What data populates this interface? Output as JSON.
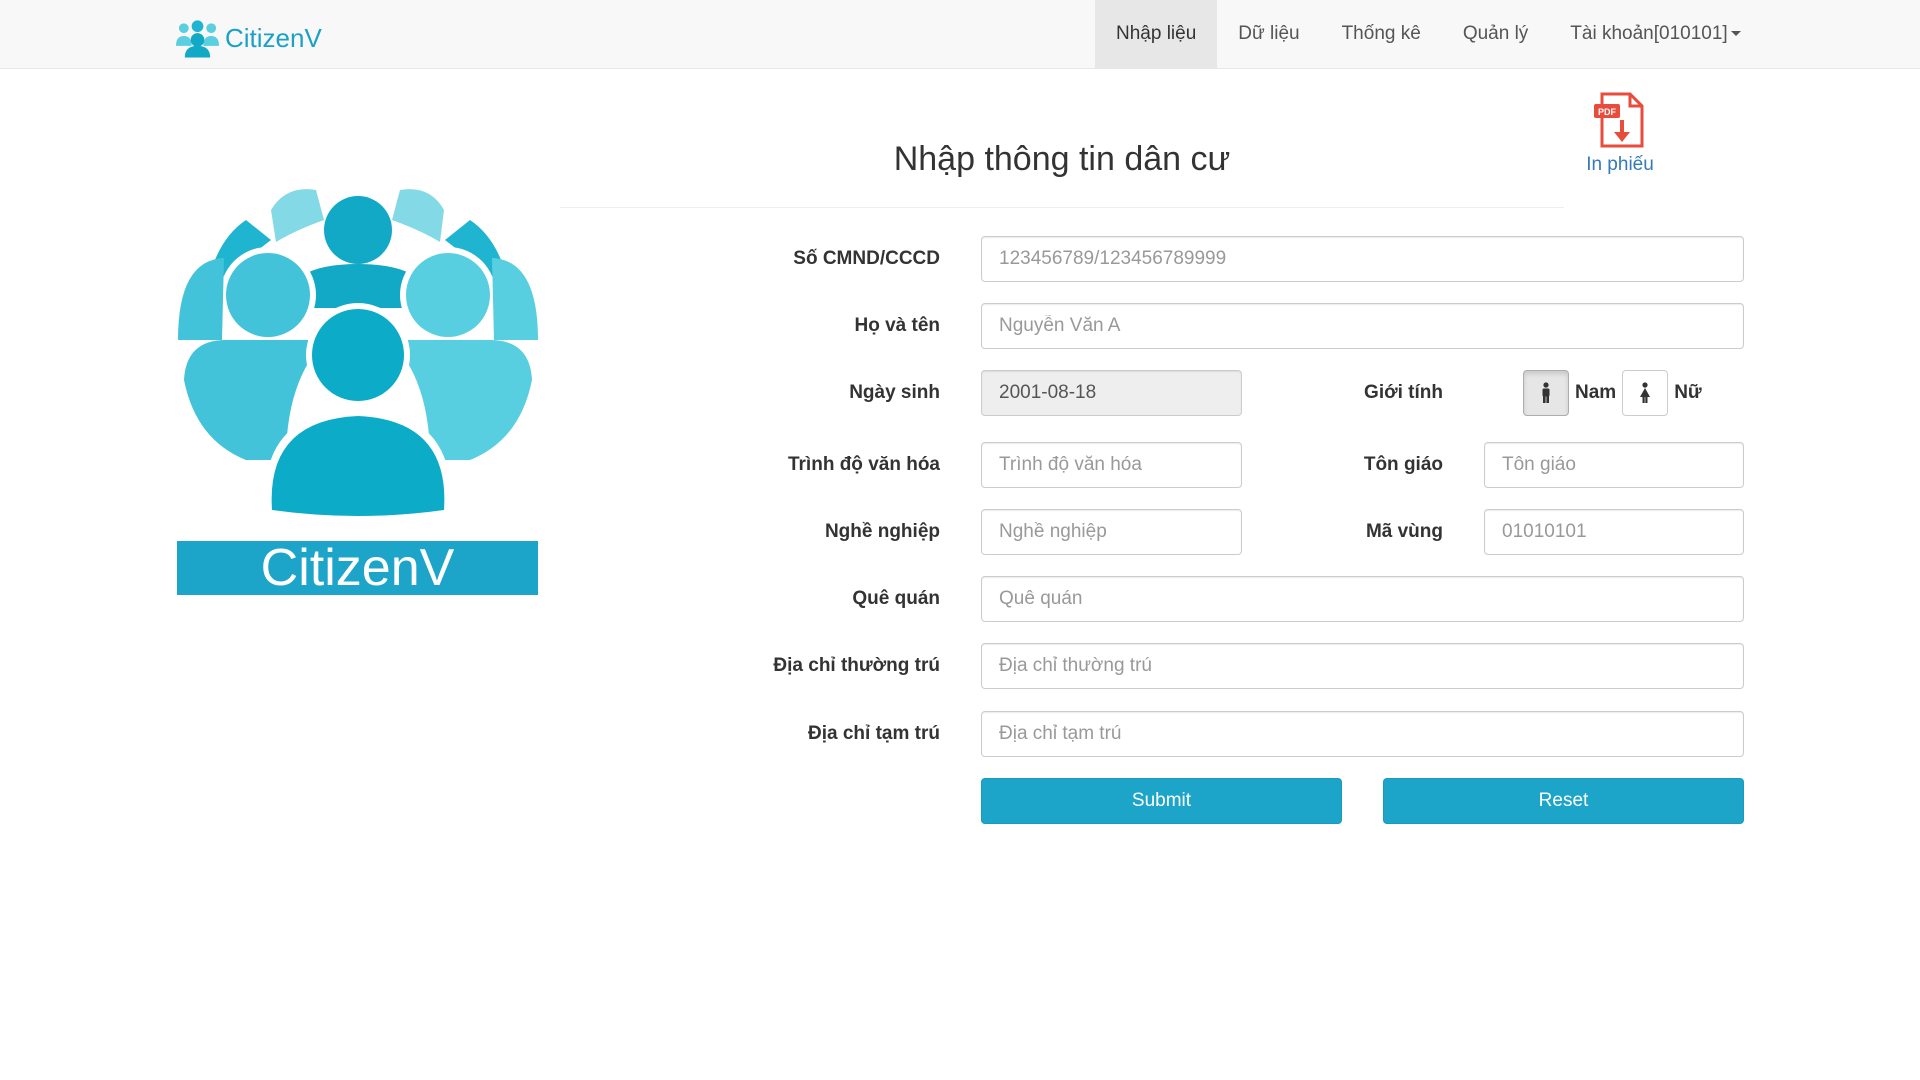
{
  "brand": {
    "name": "CitizenV",
    "logo_icon": "people-group-icon"
  },
  "nav": {
    "items": [
      "Nhập liệu",
      "Dữ liệu",
      "Thống kê",
      "Quản lý"
    ],
    "account": "Tài khoản[010101]",
    "active_index": 0
  },
  "logo": {
    "banner_text": "CitizenV"
  },
  "pdf": {
    "label": "In phiếu",
    "icon": "pdf-download-icon"
  },
  "page": {
    "title": "Nhập thông tin dân cư"
  },
  "form": {
    "cmnd": {
      "label": "Số CMND/CCCD",
      "placeholder": "123456789/123456789999"
    },
    "name": {
      "label": "Họ và tên",
      "placeholder": "Nguyễn Văn A"
    },
    "dob": {
      "label": "Ngày sinh",
      "value": "2001-08-18"
    },
    "gender": {
      "label": "Giới tính",
      "male": "Nam",
      "female": "Nữ",
      "selected": "Nam"
    },
    "education": {
      "label": "Trình độ văn hóa",
      "placeholder": "Trình độ văn hóa"
    },
    "religion": {
      "label": "Tôn giáo",
      "placeholder": "Tôn giáo"
    },
    "job": {
      "label": "Nghề nghiệp",
      "placeholder": "Nghề nghiệp"
    },
    "region": {
      "label": "Mã vùng",
      "placeholder": "01010101"
    },
    "hometown": {
      "label": "Quê quán",
      "placeholder": "Quê quán"
    },
    "permanent": {
      "label": "Địa chỉ thường trú",
      "placeholder": "Địa chỉ thường trú"
    },
    "temporary": {
      "label": "Địa chỉ tạm trú",
      "placeholder": "Địa chỉ tạm trú"
    },
    "submit": "Submit",
    "reset": "Reset"
  },
  "colors": {
    "accent": "#1ca4c9",
    "link": "#337ab7",
    "pdf_red": "#e74c3c"
  }
}
